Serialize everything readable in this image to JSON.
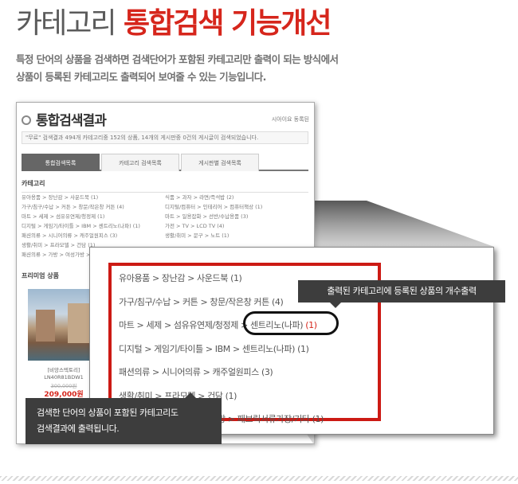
{
  "header": {
    "title_gray": "카테고리",
    "title_red": "통합검색 기능개선",
    "desc_line1": "특정 단어의 상품을 검색하면 검색단어가 포함된 카테고리만 출력이 되는 방식에서",
    "desc_line2": "상품이 등록된 카테고리도 출력되어 보여줄 수 있는 기능입니다."
  },
  "screenshot": {
    "title": "통합검색결과",
    "top_right": "시아이요 동록된",
    "info_bar": "\"무료\" 검색결과   494개 카테고리중 152의 상품, 14개의 게시판중 0건의 게시글이 검색되었습니다.",
    "tabs": [
      "통합검색목록",
      "카테고리 검색목록",
      "게시판별 검색목록"
    ],
    "category_heading": "카테고리",
    "rows": [
      [
        "유아용품 > 장난감 > 사운드북 (1)",
        "식품 > 과자 > 라면/즉석밥 (2)"
      ],
      [
        "가구/침구/수납 > 커튼 > 창문/작은창 커튼 (4)",
        "디지털/컴퓨터 > 인테리어 > 컴퓨터책상 (1)"
      ],
      [
        "마트 > 세제 > 섬유유연제/청정제 (1)",
        "마트 > 일용잡화 > 선반/수납용품 (3)"
      ],
      [
        "디지털 > 게임기/타이틀 > IBM > 센트리노(나파) (1)",
        "가전 > TV > LCD TV (4)"
      ],
      [
        "패션의류 > 시니어의류 > 캐주얼원피스 (3)",
        "생활/취미 > 문구 > 노트 (1)"
      ],
      [
        "생활/취미 > 프라모델 > 건담 (1)",
        ""
      ],
      [
        "패션의류 > 가방 > 여성가방 > 패브릭 (1)",
        ""
      ]
    ],
    "premium_heading": "프리미엄 상품",
    "product_name": "[비앙스텍토리] LN40R81BDW1",
    "product_old_price": "300,000원",
    "product_price": "209,000원"
  },
  "zoom": {
    "lines": [
      {
        "path": "유아용품 > 장난감 > 사운드북",
        "count": "(1)"
      },
      {
        "path": "가구/침구/수납 > 커튼 > 창문/작은창 커튼",
        "count": "(4)"
      },
      {
        "path": "마트 > 세제 > 섬유유연제/청정제 > ",
        "hl": "센트리노(나파)",
        "count": "(1)"
      },
      {
        "path": "디지털 > 게임기/타이틀 > IBM > 센트리노(나파)",
        "count": "(1)"
      },
      {
        "path": "패션의류 > 시니어의류 > 캐주얼원피스",
        "count": "(3)"
      },
      {
        "path": "생활/취미 > 프라모델 > 건담",
        "count": "(1)"
      },
      {
        "path": "방 > 패브릭서류가장/기타",
        "count": "(1)"
      }
    ]
  },
  "tips": {
    "top": "출력된 카테고리에 등록된 상품의 개수출력",
    "bottom_line1": "검색한 단어의 상품이 포함된 카테고리도",
    "bottom_line2": "검색결과에 출력됩니다."
  }
}
